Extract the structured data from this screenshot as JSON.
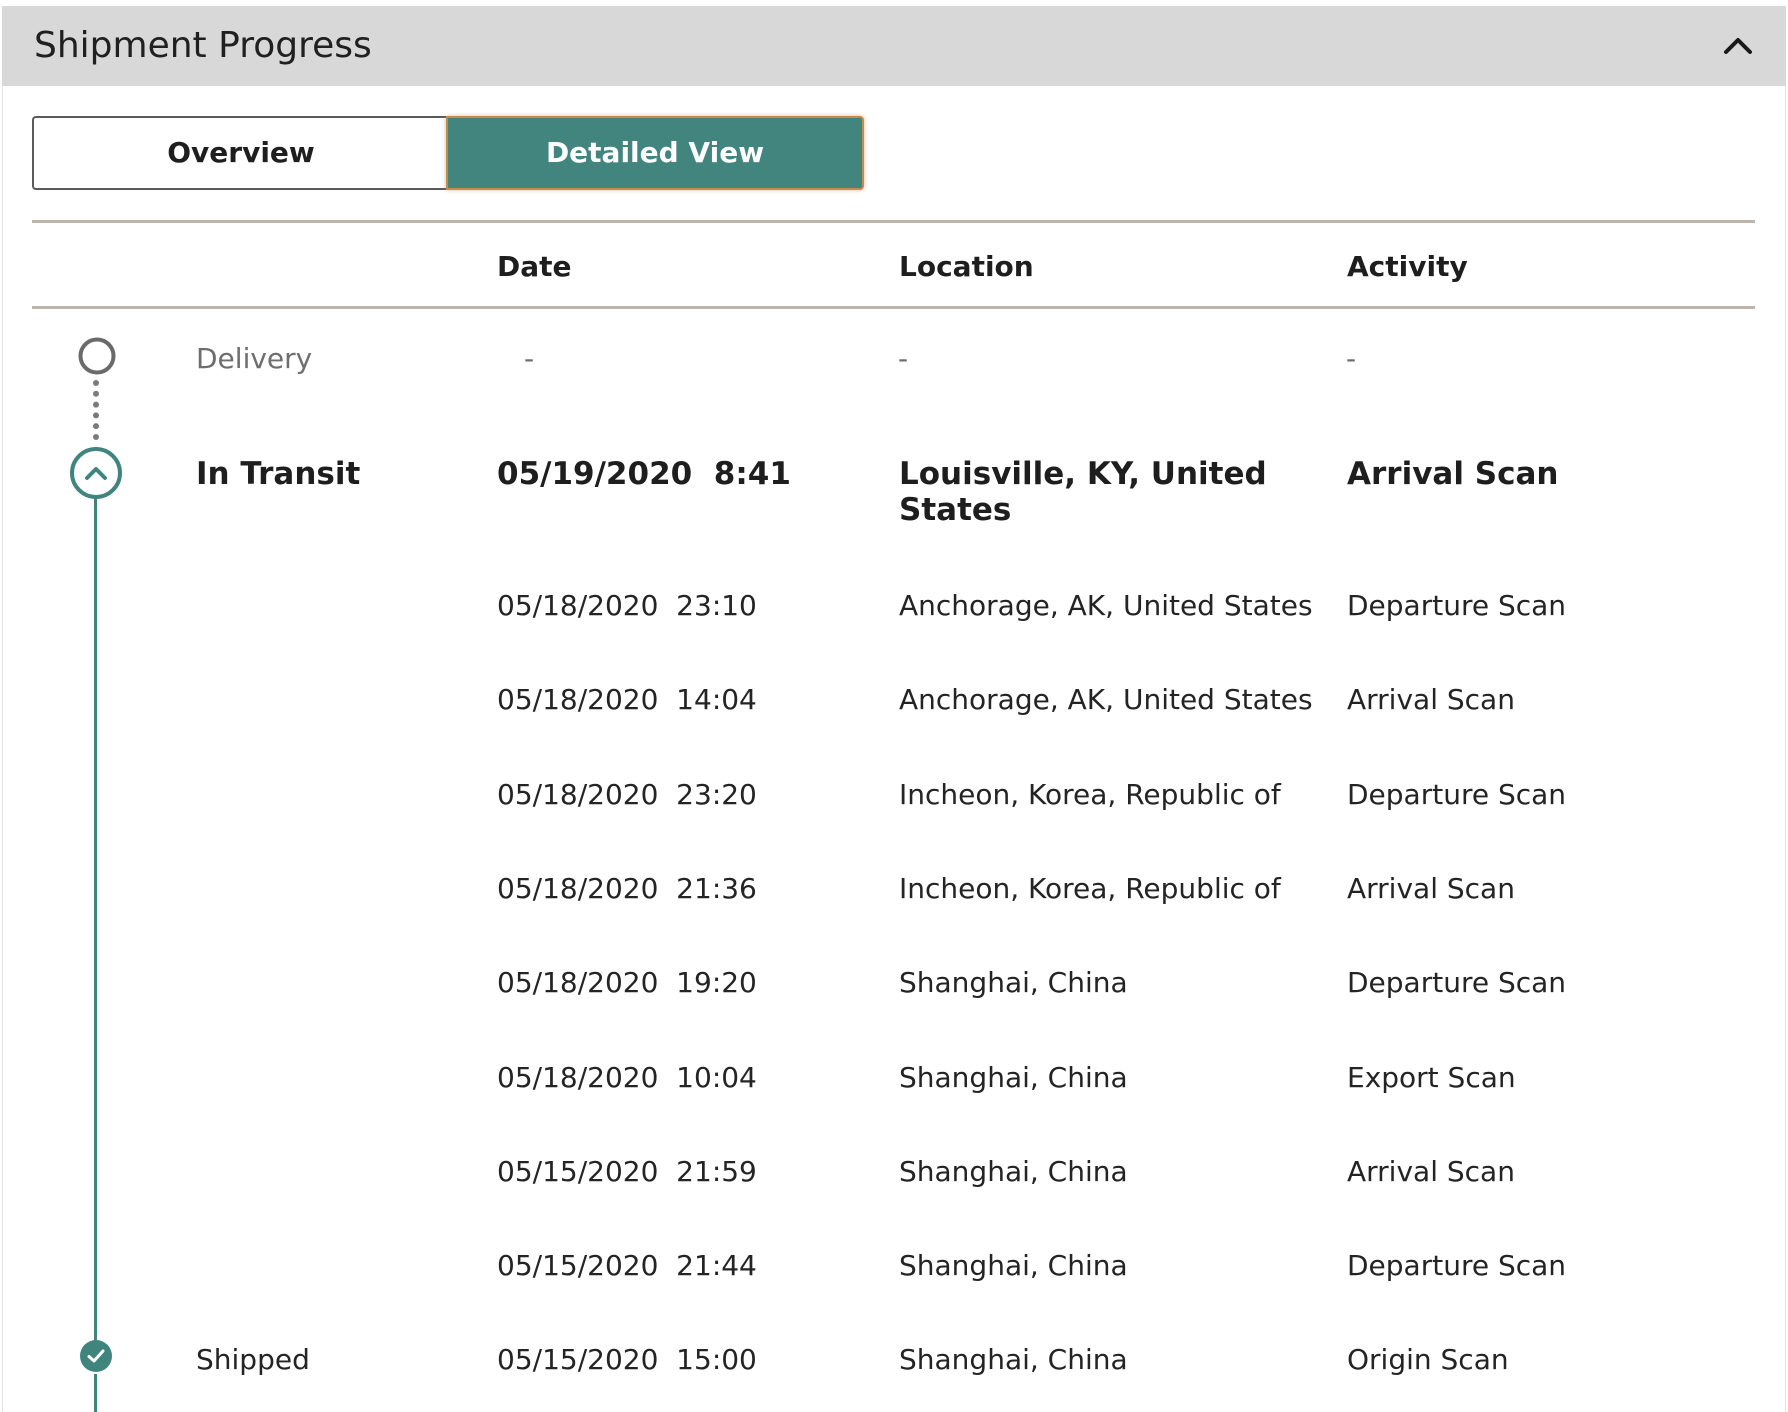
{
  "panel": {
    "title": "Shipment Progress"
  },
  "view_toggle": {
    "options": [
      "Overview",
      "Detailed View"
    ],
    "selected": "Detailed View"
  },
  "table": {
    "headers": {
      "status": "",
      "date": "Date",
      "location": "Location",
      "activity": "Activity"
    }
  },
  "milestones": {
    "delivery": {
      "label": "Delivery",
      "date": "-",
      "location": "-",
      "activity": "-"
    },
    "in_transit": {
      "label": "In Transit",
      "date": "05/19/2020  8:41",
      "location": "Louisville, KY, United States",
      "activity": "Arrival Scan"
    },
    "shipped": {
      "label": "Shipped",
      "date": "05/15/2020  15:00",
      "location": "Shanghai, China",
      "activity": "Origin Scan"
    }
  },
  "events": [
    {
      "date": "05/18/2020  23:10",
      "location": "Anchorage, AK, United States",
      "activity": "Departure Scan"
    },
    {
      "date": "05/18/2020  14:04",
      "location": "Anchorage, AK, United States",
      "activity": "Arrival Scan"
    },
    {
      "date": "05/18/2020  23:20",
      "location": "Incheon, Korea, Republic of",
      "activity": "Departure Scan"
    },
    {
      "date": "05/18/2020  21:36",
      "location": "Incheon, Korea, Republic of",
      "activity": "Arrival Scan"
    },
    {
      "date": "05/18/2020  19:20",
      "location": "Shanghai, China",
      "activity": "Departure Scan"
    },
    {
      "date": "05/18/2020  10:04",
      "location": "Shanghai, China",
      "activity": "Export Scan"
    },
    {
      "date": "05/15/2020  21:59",
      "location": "Shanghai, China",
      "activity": "Arrival Scan"
    },
    {
      "date": "05/15/2020  21:44",
      "location": "Shanghai, China",
      "activity": "Departure Scan"
    }
  ],
  "colors": {
    "accent": "#41857e",
    "header_bg": "#d8d8d8",
    "rule": "#bdb5aa",
    "selected_border": "#c58a4c"
  },
  "icons": {
    "collapse": "chevron-up-icon",
    "pending": "empty-circle-icon",
    "current": "chevron-up-circle-icon",
    "complete": "check-circle-icon"
  }
}
